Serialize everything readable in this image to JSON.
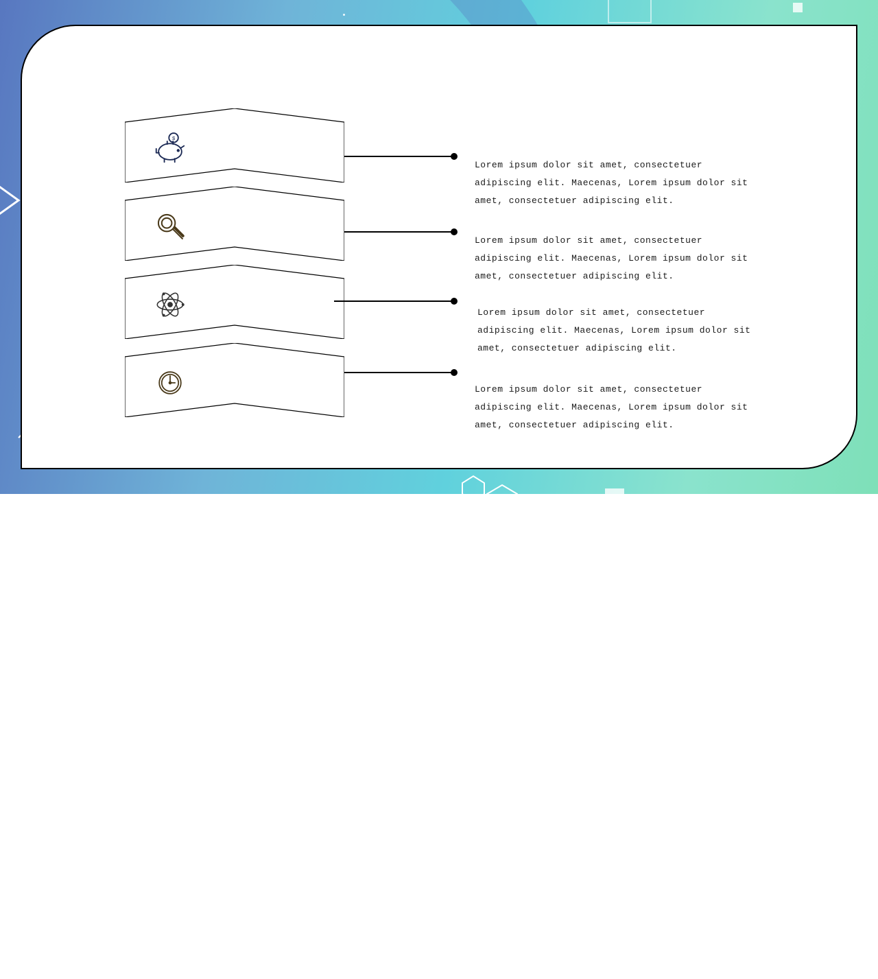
{
  "items": [
    {
      "icon": "piggy-bank-icon",
      "text": "Lorem ipsum dolor sit amet, consectetuer adipiscing elit. Maecenas, Lorem ipsum dolor sit amet, consectetuer adipiscing elit."
    },
    {
      "icon": "magnifier-icon",
      "text": "Lorem ipsum dolor sit amet, consectetuer adipiscing elit. Maecenas, Lorem ipsum dolor sit amet, consectetuer adipiscing elit."
    },
    {
      "icon": "atom-icon",
      "text": "Lorem ipsum dolor sit amet, consectetuer adipiscing elit. Maecenas, Lorem ipsum dolor sit amet, consectetuer adipiscing elit."
    },
    {
      "icon": "clock-icon",
      "text": "Lorem ipsum dolor sit amet, consectetuer adipiscing elit. Maecenas, Lorem ipsum dolor sit amet, consectetuer adipiscing elit."
    }
  ]
}
